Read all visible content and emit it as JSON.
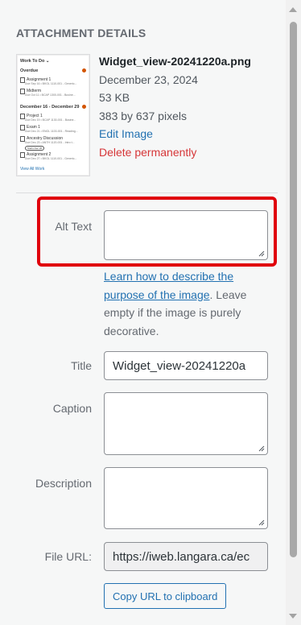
{
  "section_title": "ATTACHMENT DETAILS",
  "thumbnail": {
    "header": "Work To Do",
    "overdue": "Overdue",
    "item1": "Assignment 1",
    "item1_sub": "Due Sep 16 • BKOL 1110-001 - Generic...",
    "item2": "Midterm",
    "item2_sub": "Due Oct 11 • BCAP 1300-001 - Busine...",
    "range": "December 16 - December 29",
    "item3": "Project 1",
    "item3_sub": "Due Dec 19 • BCAP 1130-001 - Busine...",
    "item4": "Exam 1",
    "item4_sub": "Due Dec 21 • ENGL 1100-001 - Reading...",
    "item5": "Ancestry Discussion",
    "item5_sub": "Due Dec 23 • ANTH 1120-001 - Intro t...",
    "item5_pill": "Starts Dec 20",
    "item6": "Assignment 2",
    "item6_sub": "Due Dec 27 • BKOL 1110-001 - Generic...",
    "footer": "View All Work"
  },
  "meta": {
    "filename": "Widget_view-20241220a.png",
    "date": "December 23, 2024",
    "size": "53 KB",
    "dimensions": "383 by 637 pixels",
    "edit_link": "Edit Image",
    "delete_link": "Delete permanently"
  },
  "fields": {
    "alt_text_label": "Alt Text",
    "alt_text_value": "",
    "help_link": "Learn how to describe the purpose of the image",
    "help_text": ". Leave empty if the image is purely decorative.",
    "title_label": "Title",
    "title_value": "Widget_view-20241220a",
    "caption_label": "Caption",
    "caption_value": "",
    "description_label": "Description",
    "description_value": "",
    "file_url_label": "File URL:",
    "file_url_value": "https://iweb.langara.ca/ec",
    "copy_button": "Copy URL to clipboard"
  },
  "colors": {
    "accent": "#2271b1",
    "delete": "#d63638",
    "highlight": "#e0000b"
  }
}
